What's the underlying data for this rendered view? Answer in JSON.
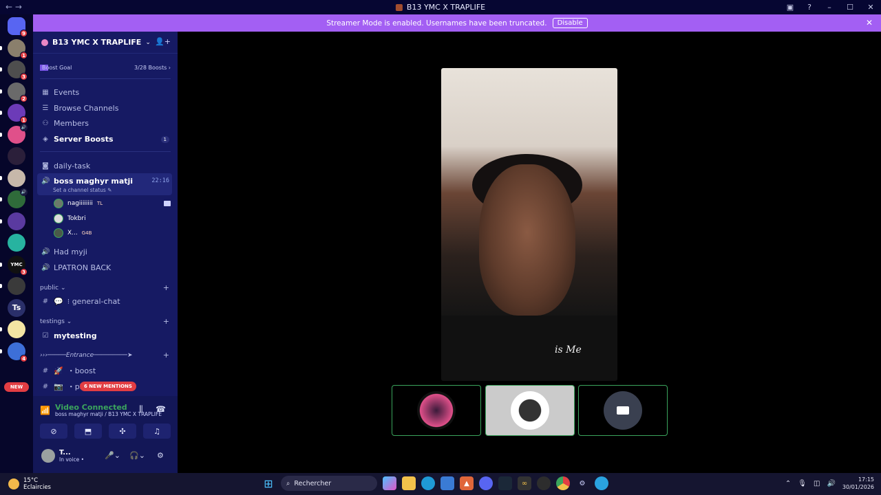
{
  "window": {
    "title": "B13 YMC X TRAPLIFE",
    "nav": "← →"
  },
  "banner": {
    "text": "Streamer Mode is enabled. Usernames have been truncated.",
    "button": "Disable"
  },
  "servers": [
    {
      "label": "",
      "badge": "9",
      "color": "#5865f2"
    },
    {
      "label": "",
      "badge": "1",
      "color": "#8a7f6c"
    },
    {
      "label": "",
      "badge": "3",
      "color": "#4e4e4e"
    },
    {
      "label": "",
      "badge": "2",
      "color": "#6a6a6a"
    },
    {
      "label": "",
      "badge": "1",
      "color": "#6c3bb8"
    },
    {
      "label": "",
      "badge": "",
      "color": "#e0508a"
    },
    {
      "label": "",
      "badge": "",
      "color": "#2b1f3a"
    },
    {
      "label": "",
      "badge": "",
      "color": "#c7b8aa"
    },
    {
      "label": "",
      "badge": "",
      "color": "#2f6b3a"
    },
    {
      "label": "",
      "badge": "",
      "color": "#5a3aa0"
    },
    {
      "label": "",
      "badge": "",
      "color": "#27b3a0"
    },
    {
      "label": "YMC",
      "badge": "3",
      "color": "#111111"
    },
    {
      "label": "",
      "badge": "",
      "color": "#3a3a3a"
    },
    {
      "label": "Ts",
      "badge": "",
      "color": "#2a2f6a"
    },
    {
      "label": "",
      "badge": "",
      "color": "#f3e4a3"
    },
    {
      "label": "",
      "badge": "4",
      "color": "#3d6fd8"
    }
  ],
  "new_pill": "NEW",
  "server": {
    "name": "B13 YMC X TRAPLIFE"
  },
  "boost": {
    "label": "Boost Goal",
    "progress": "3/28 Boosts"
  },
  "menu": [
    {
      "label": "Events",
      "icon": "calendar-icon"
    },
    {
      "label": "Browse Channels",
      "icon": "browse-icon"
    },
    {
      "label": "Members",
      "icon": "members-icon"
    },
    {
      "label": "Server Boosts",
      "icon": "boost-icon",
      "count": "1"
    }
  ],
  "channels": {
    "daily": "daily-task",
    "voice_active": {
      "name": "boss maghyr matji",
      "time": "22:16",
      "status": "Set a channel status"
    },
    "users": [
      {
        "name": "nagiiiiiiii",
        "tag": "TL"
      },
      {
        "name": "Tokbri",
        "tag": ""
      },
      {
        "name": "X...",
        "tag": "G4B"
      }
    ],
    "voice_other": [
      "Had myji",
      "LPATRON BACK"
    ],
    "cat_public": "public",
    "general": "⁝ general-chat",
    "cat_testings": "testings",
    "mytesting": "mytesting",
    "cat_entrance": "›››─────Entrance─────────➤",
    "boost_ch": "・boost",
    "pic_ch": "・pic",
    "mentions": "6 NEW MENTIONS"
  },
  "voice_panel": {
    "status": "Video Connected",
    "sub": "boss maghyr matji / B13 YMC X TRAPLIFE"
  },
  "me": {
    "name": "T...",
    "status": "In voice •"
  },
  "taskbar": {
    "temp": "15°C",
    "weather": "Eclaircies",
    "search": "Rechercher",
    "time": "17:15",
    "date": "30/01/2026"
  }
}
